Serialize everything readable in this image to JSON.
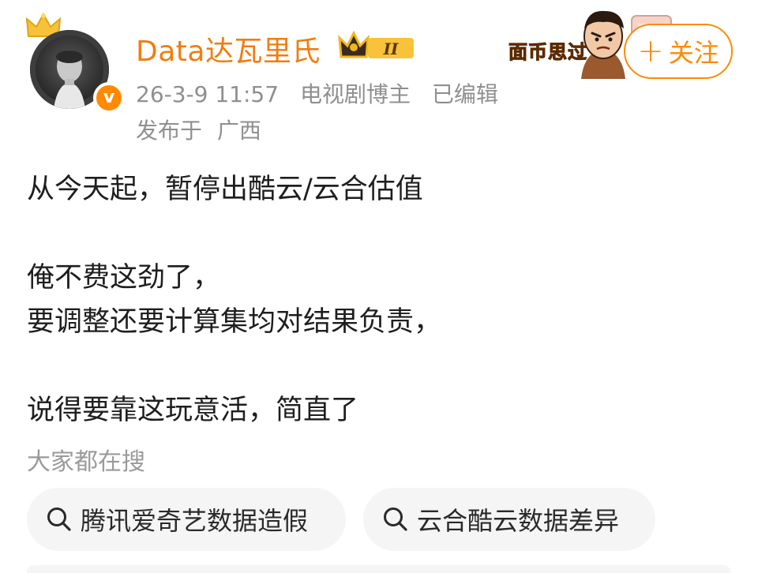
{
  "post": {
    "author": {
      "name": "Data达瓦里氏",
      "level_badge": "II",
      "verified_mark": "v",
      "avatar_icon": "portrait-avatar",
      "crown_icon": "crown-icon"
    },
    "meta": {
      "time": "26-3-9 11:57",
      "role": "电视剧博主",
      "edited": "已编辑",
      "location_prefix": "发布于",
      "location": "广西"
    },
    "sticker_text": "面币思过",
    "follow_label": "关注",
    "follow_icon": "plus-icon",
    "lines": [
      "从今天起，暂停出酷云/云合估值",
      "俺不费这劲了，",
      "要调整还要计算集均对结果负责，",
      "说得要靠这玩意活，简直了"
    ]
  },
  "search": {
    "title": "大家都在搜",
    "chips": [
      {
        "label": "腾讯爱奇艺数据造假",
        "icon": "search-icon"
      },
      {
        "label": "云合酷云数据差异",
        "icon": "search-icon"
      }
    ]
  },
  "colors": {
    "accent": "#ff8a00",
    "username": "#f07d10",
    "meta_gray": "#8f8f8f",
    "chip_bg": "#f5f5f5"
  }
}
